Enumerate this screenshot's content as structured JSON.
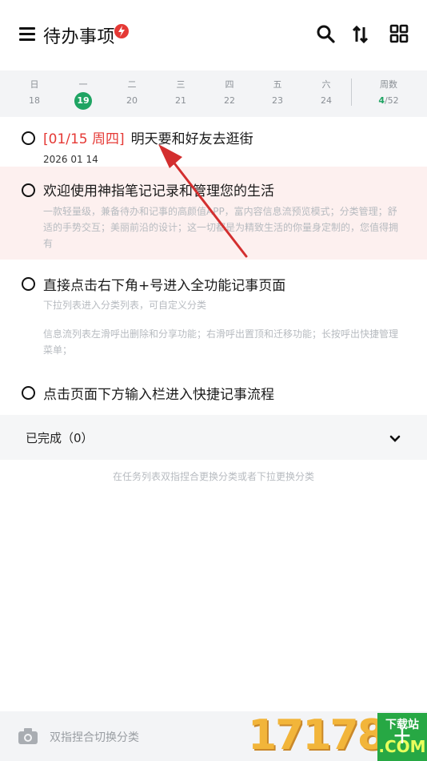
{
  "header": {
    "title": "待办事项",
    "icons": [
      "menu-icon",
      "flash-badge-icon",
      "search-icon",
      "sort-icon",
      "grid-icon"
    ]
  },
  "week": {
    "days": [
      {
        "weekday": "日",
        "date": "18"
      },
      {
        "weekday": "一",
        "date": "19",
        "today": true
      },
      {
        "weekday": "二",
        "date": "20"
      },
      {
        "weekday": "三",
        "date": "21"
      },
      {
        "weekday": "四",
        "date": "22"
      },
      {
        "weekday": "五",
        "date": "23"
      },
      {
        "weekday": "六",
        "date": "24"
      }
    ],
    "week_label": "周数",
    "week_current": "4",
    "week_total": "/52"
  },
  "tasks": [
    {
      "date_tag": "[01/15 周四]",
      "title": "明天要和好友去逛街",
      "date": "2026 01 14"
    },
    {
      "title": "欢迎使用神指笔记记录和管理您的生活",
      "sub": "一款轻量级，兼备待办和记事的高颜值APP，富内容信息流预览模式；分类管理；舒适的手势交互；美丽前沿的设计；这一切都是为精致生活的你量身定制的，您值得拥有"
    },
    {
      "title": "直接点击右下角+号进入全功能记事页面",
      "sub": "下拉列表进入分类列表，可自定义分类",
      "sub2": "信息流列表左滑呼出删除和分享功能；右滑呼出置顶和迁移功能；长按呼出快捷管理菜单；"
    },
    {
      "title": "点击页面下方输入栏进入快捷记事流程"
    }
  ],
  "completed": {
    "label": "已完成（0）"
  },
  "hint": "在任务列表双指捏合更换分类或者下拉更换分类",
  "bottom": {
    "placeholder": "双指捏合切换分类",
    "add": "+"
  },
  "watermark": {
    "number": "17178",
    "top": "下载站",
    "com": ".COM"
  },
  "colors": {
    "accent_green": "#1fa463",
    "date_red": "#e53935",
    "highlight_bg": "#fdf0ef",
    "annotation_arrow": "#d32f2f"
  }
}
